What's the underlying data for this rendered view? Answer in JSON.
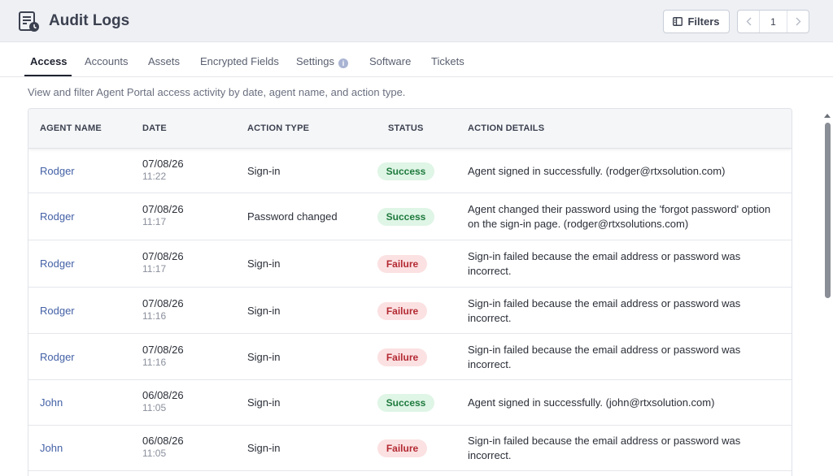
{
  "header": {
    "title": "Audit Logs",
    "logo_icon": "audit-log-icon",
    "filters_label": "Filters",
    "filters_icon": "filter-panel-icon",
    "page_number": "1"
  },
  "tabs": [
    {
      "label": "Access",
      "active": true
    },
    {
      "label": "Accounts",
      "active": false
    },
    {
      "label": "Assets",
      "active": false
    },
    {
      "label": "Encrypted Fields",
      "active": false
    },
    {
      "label": "Settings",
      "active": false,
      "has_info": true,
      "info_glyph": "i"
    },
    {
      "label": "Software",
      "active": false
    },
    {
      "label": "Tickets",
      "active": false
    }
  ],
  "description": "View and filter Agent Portal access activity by date, agent name, and action type.",
  "table": {
    "columns": [
      "AGENT NAME",
      "DATE",
      "ACTION TYPE",
      "STATUS",
      "ACTION DETAILS"
    ],
    "rows": [
      {
        "agent": "Rodger",
        "date": "07/08/26",
        "time": "11:22",
        "action": "Sign-in",
        "status": "Success",
        "details": "Agent signed in successfully. (rodger@rtxsolution.com)"
      },
      {
        "agent": "Rodger",
        "date": "07/08/26",
        "time": "11:17",
        "action": "Password changed",
        "status": "Success",
        "details": "Agent changed their password using the 'forgot password' option on the sign-in page. (rodger@rtxsolutions.com)"
      },
      {
        "agent": "Rodger",
        "date": "07/08/26",
        "time": "11:17",
        "action": "Sign-in",
        "status": "Failure",
        "details": "Sign-in failed because the email address or password was incorrect."
      },
      {
        "agent": "Rodger",
        "date": "07/08/26",
        "time": "11:16",
        "action": "Sign-in",
        "status": "Failure",
        "details": "Sign-in failed because the email address or password was incorrect."
      },
      {
        "agent": "Rodger",
        "date": "07/08/26",
        "time": "11:16",
        "action": "Sign-in",
        "status": "Failure",
        "details": "Sign-in failed because the email address or password was incorrect."
      },
      {
        "agent": "John",
        "date": "06/08/26",
        "time": "11:05",
        "action": "Sign-in",
        "status": "Success",
        "details": "Agent signed in successfully. (john@rtxsolution.com)"
      },
      {
        "agent": "John",
        "date": "06/08/26",
        "time": "11:05",
        "action": "Sign-in",
        "status": "Failure",
        "details": "Sign-in failed because the email address or password was incorrect."
      }
    ]
  },
  "colors": {
    "agent_link": "#4461a6",
    "success_bg": "#dff5e6",
    "success_text": "#1e7a3d",
    "failure_bg": "#fbe1e2",
    "failure_text": "#b42a33"
  }
}
